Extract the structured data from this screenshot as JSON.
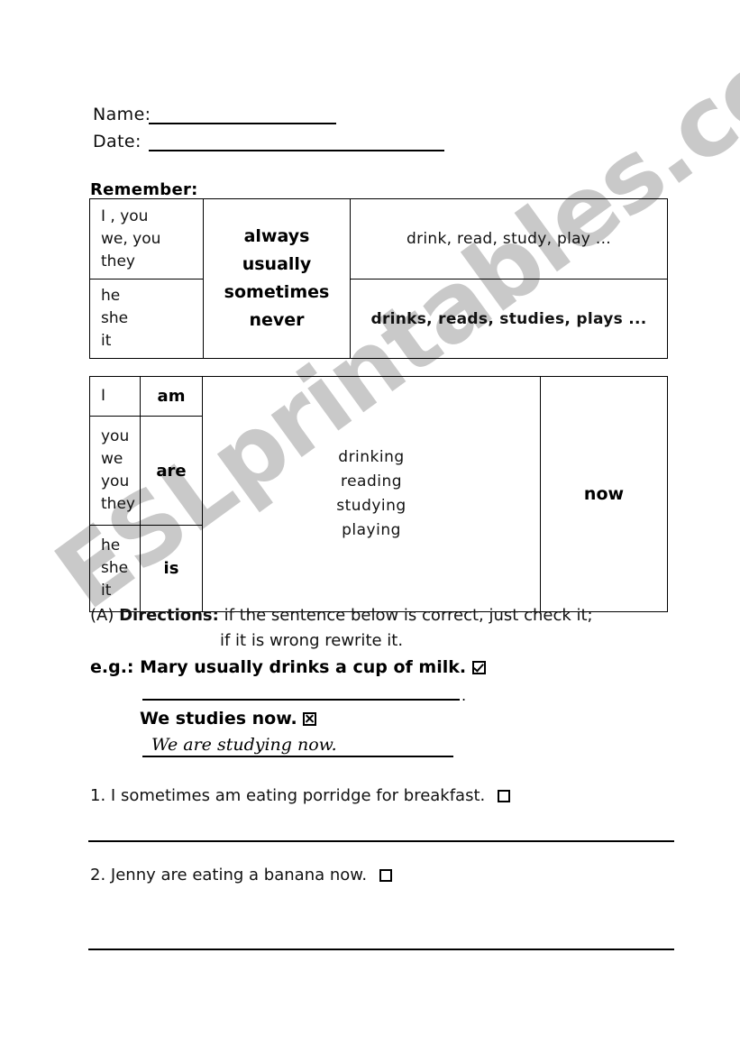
{
  "watermark": {
    "text": "ESLprintables.com"
  },
  "header": {
    "name_label": "Name:",
    "date_label": "Date:"
  },
  "remember": {
    "title": "Remember:"
  },
  "table_simple_present": {
    "rows": [
      {
        "subjects": [
          "I , you",
          "we, you",
          "they"
        ],
        "verbs": "drink, read, study, play ..."
      },
      {
        "subjects": [
          "he",
          "she",
          "it"
        ],
        "verbs": "drinks, reads, studies, plays ..."
      }
    ],
    "adverbs": [
      "always",
      "usually",
      "sometimes",
      "never"
    ]
  },
  "table_present_continuous": {
    "rows": [
      {
        "subjects": [
          "I"
        ],
        "be": "am"
      },
      {
        "subjects": [
          "you",
          "we",
          "you",
          "they"
        ],
        "be": "are"
      },
      {
        "subjects": [
          "he",
          "she",
          "it"
        ],
        "be": "is"
      }
    ],
    "verbs": [
      "drinking",
      "reading",
      "studying",
      "playing"
    ],
    "time": "now"
  },
  "directions": {
    "marker": "(A)",
    "label": "Directions:",
    "line1": "if the sentence below is correct, just check it;",
    "line2": "if it is wrong rewrite it."
  },
  "example": {
    "eg_label": "e.g.:",
    "correct_sentence": "Mary usually drinks a cup of milk.",
    "correct_mark": "checked",
    "trailing_period": ".",
    "wrong_sentence": "We studies now.",
    "wrong_mark": "crossed",
    "rewrite": "We are studying now."
  },
  "questions": [
    {
      "number": "1.",
      "text": "I sometimes am eating porridge for breakfast.",
      "mark": "empty"
    },
    {
      "number": "2.",
      "text": "Jenny are eating a banana now.",
      "mark": "empty"
    }
  ]
}
